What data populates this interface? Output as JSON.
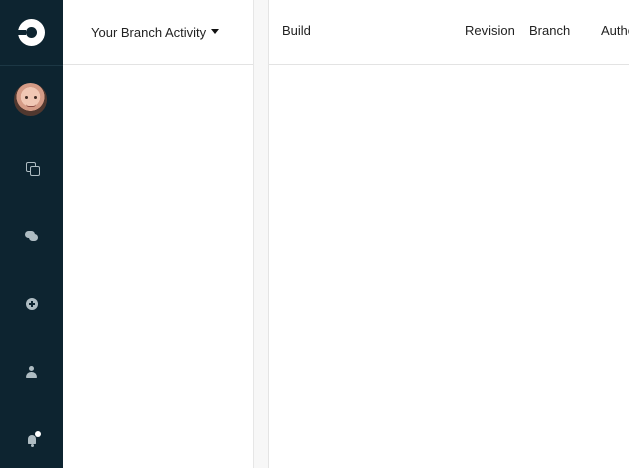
{
  "navigation": {
    "logo_icon": "circleci-logo-icon",
    "items": [
      {
        "name": "avatar"
      },
      {
        "name": "builds",
        "icon": "copy-icon"
      },
      {
        "name": "messages",
        "icon": "chat-icon"
      },
      {
        "name": "add-projects",
        "icon": "plus-circle-icon"
      },
      {
        "name": "account",
        "icon": "user-icon"
      },
      {
        "name": "notifications",
        "icon": "bell-icon"
      }
    ],
    "background_color": "#0d2430"
  },
  "branch_panel": {
    "title": "Your Branch Activity"
  },
  "builds_table": {
    "columns": [
      "Build",
      "Revision",
      "Branch",
      "Author"
    ]
  }
}
